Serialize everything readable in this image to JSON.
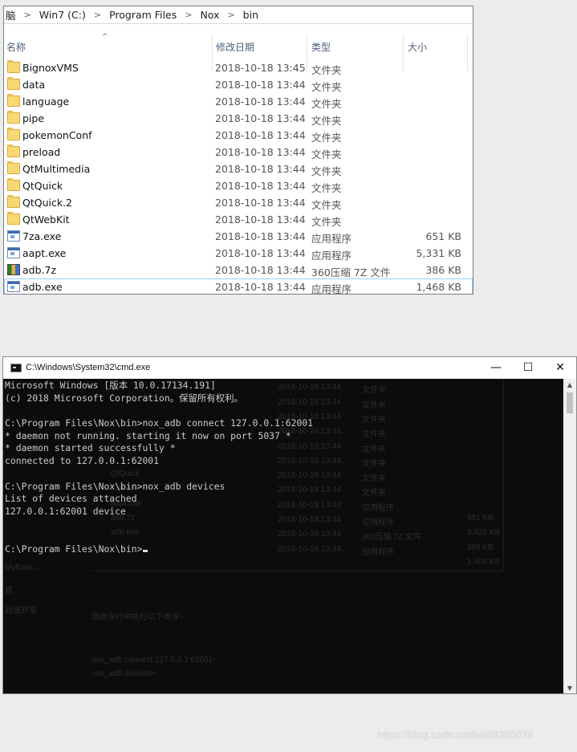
{
  "explorer": {
    "breadcrumb": [
      "脑",
      "Win7 (C:)",
      "Program Files",
      "Nox",
      "bin"
    ],
    "sort_indicator": "^",
    "columns": {
      "name": "名称",
      "date": "修改日期",
      "type": "类型",
      "size": "大小"
    },
    "rows": [
      {
        "icon": "folder-icon",
        "name": "BignoxVMS",
        "date": "2018-10-18 13:45",
        "type": "文件夹",
        "size": ""
      },
      {
        "icon": "folder-icon",
        "name": "data",
        "date": "2018-10-18 13:44",
        "type": "文件夹",
        "size": ""
      },
      {
        "icon": "folder-icon",
        "name": "language",
        "date": "2018-10-18 13:44",
        "type": "文件夹",
        "size": ""
      },
      {
        "icon": "folder-icon",
        "name": "pipe",
        "date": "2018-10-18 13:44",
        "type": "文件夹",
        "size": ""
      },
      {
        "icon": "folder-icon",
        "name": "pokemonConf",
        "date": "2018-10-18 13:44",
        "type": "文件夹",
        "size": ""
      },
      {
        "icon": "folder-icon",
        "name": "preload",
        "date": "2018-10-18 13:44",
        "type": "文件夹",
        "size": ""
      },
      {
        "icon": "folder-icon",
        "name": "QtMultimedia",
        "date": "2018-10-18 13:44",
        "type": "文件夹",
        "size": ""
      },
      {
        "icon": "folder-icon",
        "name": "QtQuick",
        "date": "2018-10-18 13:44",
        "type": "文件夹",
        "size": ""
      },
      {
        "icon": "folder-icon",
        "name": "QtQuick.2",
        "date": "2018-10-18 13:44",
        "type": "文件夹",
        "size": ""
      },
      {
        "icon": "folder-icon",
        "name": "QtWebKit",
        "date": "2018-10-18 13:44",
        "type": "文件夹",
        "size": ""
      },
      {
        "icon": "exe-icon",
        "name": "7za.exe",
        "date": "2018-10-18 13:44",
        "type": "应用程序",
        "size": "651 KB"
      },
      {
        "icon": "exe-icon",
        "name": "aapt.exe",
        "date": "2018-10-18 13:44",
        "type": "应用程序",
        "size": "5,331 KB"
      },
      {
        "icon": "archive-7z-icon",
        "name": "adb.7z",
        "date": "2018-10-18 13:44",
        "type": "360压缩 7Z 文件",
        "size": "386 KB"
      },
      {
        "icon": "exe-icon",
        "name": "adb.exe",
        "date": "2018-10-18 13:44",
        "type": "应用程序",
        "size": "1,468 KB",
        "selected": true
      }
    ]
  },
  "cmd": {
    "title": "C:\\Windows\\System32\\cmd.exe",
    "buttons": {
      "minimize": "—",
      "maximize": "☐",
      "close": "✕"
    },
    "lines": [
      "Microsoft Windows [版本 10.0.17134.191]",
      "(c) 2018 Microsoft Corporation。保留所有权利。",
      "",
      "C:\\Program Files\\Nox\\bin>nox_adb connect 127.0.0.1:62001",
      "* daemon not running. starting it now on port 5037 *",
      "* daemon started successfully *",
      "connected to 127.0.0.1:62001",
      "",
      "C:\\Program Files\\Nox\\bin>nox_adb devices",
      "List of devices attached",
      "127.0.0.1:62001 device",
      "",
      "",
      "C:\\Program Files\\Nox\\bin>"
    ],
    "background_ghost": {
      "dates": [
        "2018-10-18 13:44",
        "2018-10-18 13:44",
        "2018-10-18 13:44",
        "2018-10-18 13:44",
        "2018-10-18 13:44",
        "2018-10-18 13:44",
        "2018-10-18 13:44",
        "2018-10-18 13:44",
        "2018-10-18 13:44",
        "2018-10-18 13:44",
        "2018-10-18 13:44",
        "2018-10-18 13:44",
        "2018-10-18 13:44"
      ],
      "types": [
        "文件夹",
        "文件夹",
        "文件夹",
        "文件夹",
        "文件夹",
        "文件夹",
        "文件夹",
        "文件夹",
        "文件夹",
        "应用程序",
        "应用程序",
        "360压缩 7Z 文件",
        "应用程序"
      ],
      "sizes": [
        "651 KB",
        "5,331 KB",
        "386 KB",
        "1,468 KB"
      ],
      "names": [
        "QtQuick",
        "7za.exe",
        "aapt.exe",
        "adb.7z",
        "adb.exe"
      ],
      "left_labels": [
        "MyBatis...",
        "其",
        "后端开发"
      ],
      "article": [
        "到命令行中执行以下命令~",
        "nox_adb connect 127.0.0.1:62001~",
        "nox_adb devices~"
      ]
    }
  },
  "watermark": "https://blog.csdn.net/kai46385076"
}
